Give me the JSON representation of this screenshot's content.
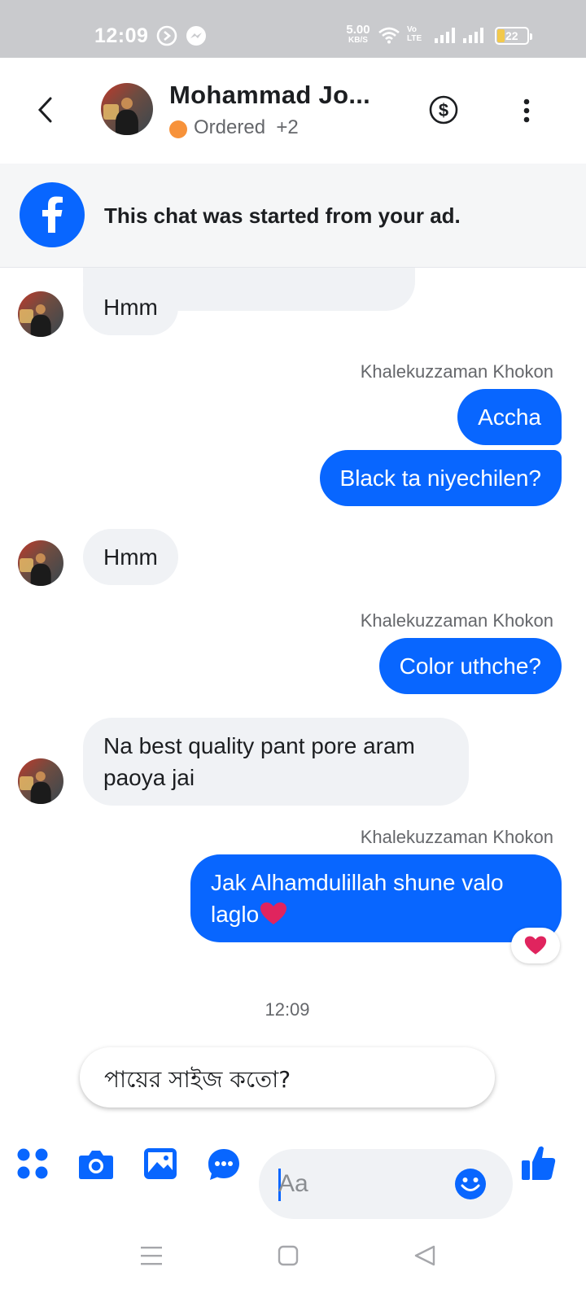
{
  "status_bar": {
    "time": "12:09",
    "net_speed_value": "5.00",
    "net_speed_unit": "KB/S",
    "volte_top": "Vo",
    "volte_bottom": "LTE",
    "battery": "22"
  },
  "header": {
    "contact_name": "Mohammad Jo...",
    "status_label": "Ordered",
    "status_extra": "+2",
    "status_dot_color": "#f7923a"
  },
  "ad_banner": {
    "text": "This chat was started from your ad."
  },
  "messages": [
    {
      "id": "m1",
      "direction": "incoming",
      "text": "Hmm"
    },
    {
      "id": "m2",
      "direction": "outgoing",
      "sender": "Khalekuzzaman Khokon",
      "text": "Accha"
    },
    {
      "id": "m3",
      "direction": "outgoing",
      "text": "Black ta niyechilen?"
    },
    {
      "id": "m4",
      "direction": "incoming",
      "text": "Hmm"
    },
    {
      "id": "m5",
      "direction": "outgoing",
      "sender": "Khalekuzzaman Khokon",
      "text": "Color uthche?"
    },
    {
      "id": "m6",
      "direction": "incoming",
      "text_line1": "Na best quality pant pore aram",
      "text_line2": "paoya jai"
    },
    {
      "id": "m7",
      "direction": "outgoing",
      "sender": "Khalekuzzaman Khokon",
      "text_line1": "Jak Alhamdulillah shune valo",
      "text_line2": "laglo",
      "reaction": "heart"
    }
  ],
  "timestamp": "12:09",
  "suggested_reply": "পায়ের সাইজ কতো?",
  "composer": {
    "placeholder": "Aa"
  },
  "colors": {
    "accent": "#0866ff",
    "incoming_bubble": "#f0f2f5",
    "heart": "#e0245e"
  }
}
